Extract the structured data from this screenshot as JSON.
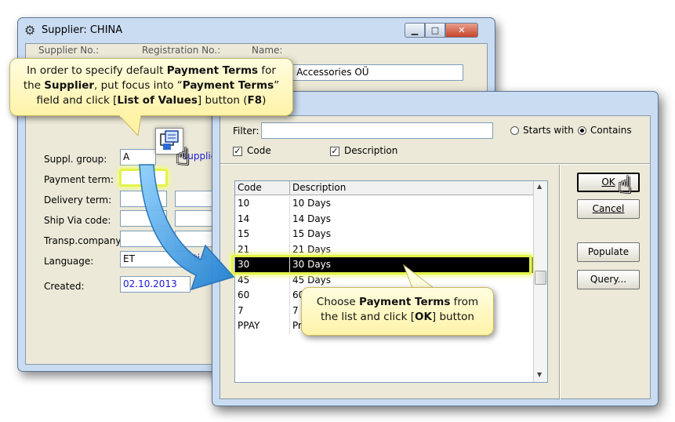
{
  "back_window": {
    "title": "Supplier: CHINA",
    "header_labels": {
      "supplier_no": "Supplier No.:",
      "registration_no": "Registration No.:",
      "name": "Name:"
    },
    "name_value": "e Accessories OÜ",
    "fields": {
      "suppl_group": {
        "label": "Suppl. group:",
        "value": "A",
        "link": "suppliers"
      },
      "payment_term": {
        "label": "Payment term:",
        "value": ""
      },
      "delivery_term": {
        "label": "Delivery term:",
        "value": ""
      },
      "ship_via": {
        "label": "Ship Via code:",
        "value": ""
      },
      "transp_company": {
        "label": "Transp.company:",
        "value": ""
      },
      "language": {
        "label": "Language:",
        "value": "ET",
        "link": "ti k"
      },
      "created": {
        "label": "Created:",
        "value": "02.10.2013"
      }
    },
    "window_buttons": {
      "minimize": "▁",
      "maximize": "□",
      "close": "✕"
    }
  },
  "lov_window": {
    "filter_label": "Filter:",
    "filter_value": "",
    "radio_starts": "Starts with",
    "radio_contains": "Contains",
    "chk_code": "Code",
    "chk_description": "Description",
    "columns": [
      "Code",
      "Description"
    ],
    "rows": [
      {
        "code": "10",
        "desc": "10 Days"
      },
      {
        "code": "14",
        "desc": "14 Days"
      },
      {
        "code": "15",
        "desc": "15 Days"
      },
      {
        "code": "21",
        "desc": "21 Days"
      },
      {
        "code": "30",
        "desc": "30 Days"
      },
      {
        "code": "45",
        "desc": "45 Days"
      },
      {
        "code": "60",
        "desc": "60"
      },
      {
        "code": "7",
        "desc": "7"
      },
      {
        "code": "PPAY",
        "desc": "Pr"
      }
    ],
    "selected_code": "30",
    "buttons": {
      "ok": "OK",
      "cancel": "Cancel",
      "populate": "Populate",
      "query": "Query..."
    }
  },
  "callouts": {
    "top": {
      "l1a": "In order to specify default ",
      "l1b": "Payment Terms",
      "l1c": " for",
      "l2a": "the ",
      "l2b": "Supplier",
      "l2c": ", put focus into “",
      "l2d": "Payment Terms",
      "l2e": "”",
      "l3a": "field and click [",
      "l3b": "List of Values",
      "l3c": "] button (",
      "l3d": "F8",
      "l3e": ")"
    },
    "bottom": {
      "l1a": "Choose ",
      "l1b": "Payment Terms",
      "l1c": " from",
      "l2a": "the list and click [",
      "l2b": "OK",
      "l2c": "] button"
    }
  },
  "colors": {
    "window_frame": "#c9dcf2",
    "client_bg": "#ece9d8",
    "highlight": "#e4f34a",
    "arrow": "#2a8fd6",
    "callout": "#fff3a8"
  },
  "icons": {
    "app": "gear-app-icon",
    "lov": "list-of-values-icon",
    "pointer": "hand-pointer-icon",
    "arrow": "curved-arrow-icon"
  }
}
